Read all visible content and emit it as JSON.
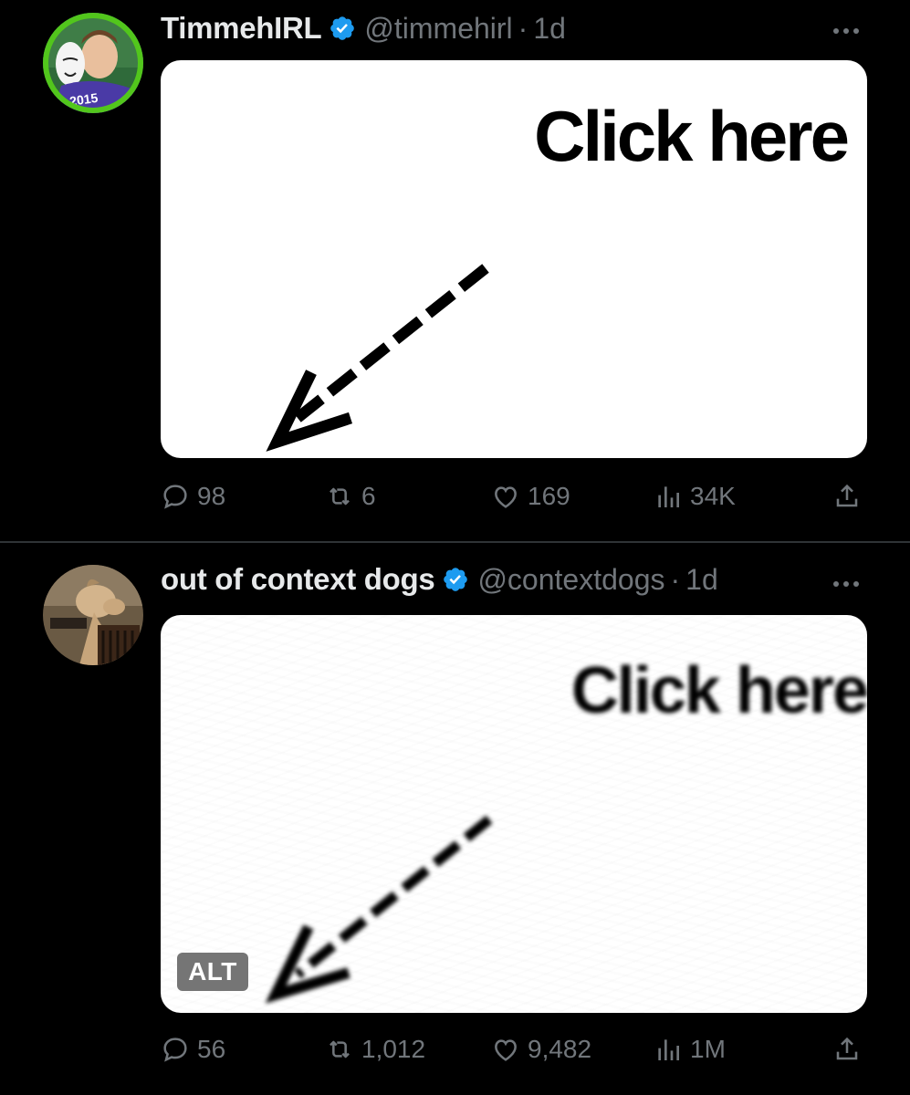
{
  "tweets": [
    {
      "display_name": "TimmehIRL",
      "handle": "@timmehirl",
      "separator": "·",
      "time": "1d",
      "verified": true,
      "media_text": "Click here",
      "stats": {
        "replies": "98",
        "retweets": "6",
        "likes": "169",
        "views": "34K"
      }
    },
    {
      "display_name": "out of context dogs",
      "handle": "@contextdogs",
      "separator": "·",
      "time": "1d",
      "verified": true,
      "media_text": "Click here",
      "alt_label": "ALT",
      "stats": {
        "replies": "56",
        "retweets": "1,012",
        "likes": "9,482",
        "views": "1M"
      }
    }
  ],
  "icons": {
    "verified": "verified-badge-icon",
    "more": "more-icon",
    "reply": "reply-icon",
    "retweet": "retweet-icon",
    "like": "heart-icon",
    "views": "views-icon",
    "share": "share-icon"
  },
  "colors": {
    "background": "#000000",
    "text_primary": "#e7e9ea",
    "text_secondary": "#71767b",
    "verified_blue": "#1d9bf0",
    "divider": "#2f3336",
    "avatar_ring": "#52c61c"
  }
}
